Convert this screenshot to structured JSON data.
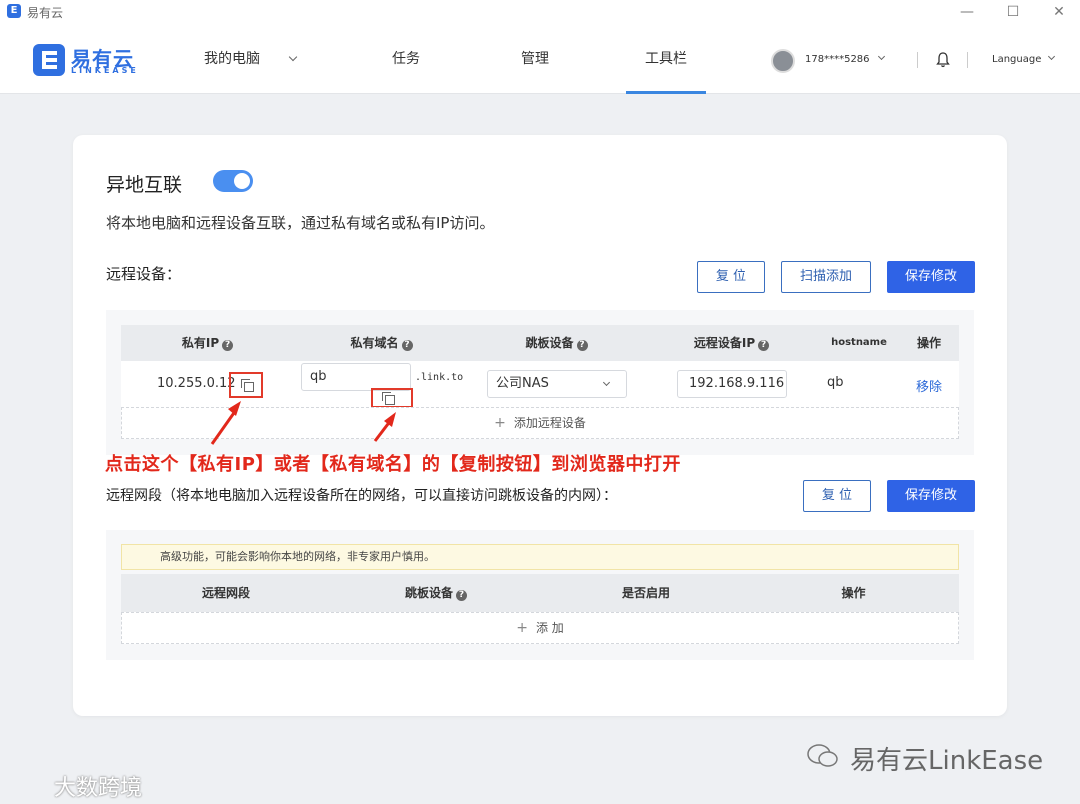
{
  "window": {
    "title": "易有云",
    "icon": "E",
    "controls": [
      "—",
      "☐",
      "✕"
    ]
  },
  "brand": {
    "name_cn": "易有云",
    "name_en": "LINKEASE"
  },
  "nav": {
    "items": [
      {
        "label": "我的电脑",
        "has_dropdown": true
      },
      {
        "label": "任务"
      },
      {
        "label": "管理"
      },
      {
        "label": "工具栏",
        "active": true
      }
    ],
    "user": "178****5286",
    "language": "Language"
  },
  "main": {
    "title": "异地互联",
    "toggle_on": true,
    "description": "将本地电脑和远程设备互联，通过私有域名或私有IP访问。",
    "remote_devices": {
      "label": "远程设备：",
      "buttons": {
        "reset": "复 位",
        "scan_add": "扫描添加",
        "save": "保存修改"
      },
      "columns": [
        "私有IP",
        "私有域名",
        "跳板设备",
        "远程设备IP",
        "hostname",
        "操作"
      ],
      "rows": [
        {
          "private_ip": "10.255.0.12",
          "domain_prefix": "qb",
          "domain_suffix": ".link.to",
          "jump_device": "公司NAS",
          "remote_ip": "192.168.9.116",
          "hostname": "qb",
          "action": "移除"
        }
      ],
      "add_label": "添加远程设备"
    },
    "annotation": "点击这个【私有IP】或者【私有域名】的【复制按钮】到浏览器中打开",
    "remote_network": {
      "label": "远程网段（将本地电脑加入远程设备所在的网络，可以直接访问跳板设备的内网）：",
      "buttons": {
        "reset": "复 位",
        "save": "保存修改"
      },
      "warning": "高级功能，可能会影响你本地的网络，非专家用户慎用。",
      "columns": [
        "远程网段",
        "跳板设备",
        "是否启用",
        "操作"
      ],
      "add_label": "添 加"
    }
  },
  "watermarks": {
    "wechat": "易有云LinkEase",
    "corner": "大数跨境"
  },
  "colors": {
    "accent": "#2f63e6",
    "annotation": "#e2281b"
  },
  "icons": [
    "help-circle-icon",
    "copy-icon",
    "chevron-down-icon",
    "bell-icon",
    "plus-icon",
    "arrow-icon"
  ]
}
